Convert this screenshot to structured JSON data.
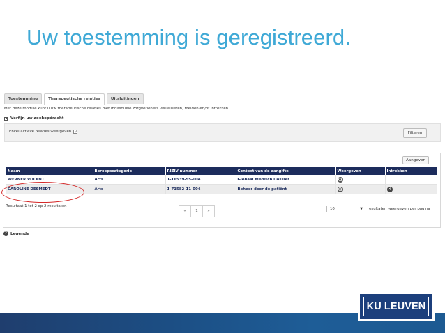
{
  "slide": {
    "title": "Uw toestemming is geregistreerd."
  },
  "tabs": [
    {
      "label": "Toestemming",
      "active": false
    },
    {
      "label": "Therapeutische relaties",
      "active": true
    },
    {
      "label": "Uitsluitingen",
      "active": false
    }
  ],
  "intro_text": "Met deze module kunt u uw therapeutische relaties met individuele zorgverleners visualiseren, melden en/of intrekken.",
  "refine": {
    "header": "Verfijn uw zoekopdracht",
    "checkbox_label": "Enkel actieve relaties weergeven",
    "checkbox_checked": true,
    "filter_button": "Filteren"
  },
  "add_button": "Aangeven",
  "table": {
    "columns": [
      "Naam",
      "Beroepscategorie",
      "RIZIV-nummer",
      "Context van de aangifte",
      "Weergeven",
      "Intrekken"
    ],
    "rows": [
      {
        "name": "WERNER VOLANT",
        "category": "Arts",
        "riziv": "1-16539-55-004",
        "context": "Globaal Medisch Dossier",
        "view_icon": "magnifier-icon",
        "revoke_icon": ""
      },
      {
        "name": "CAROLINE DESMEDT",
        "category": "Arts",
        "riziv": "1-71582-11-004",
        "context": "Beheer door de patiënt",
        "view_icon": "magnifier-icon",
        "revoke_icon": "close-circle-icon"
      }
    ]
  },
  "result_info": "Resultaat 1 tot 2 op 2 resultaten",
  "pagination": {
    "prev": "«",
    "page": "1",
    "next": "»"
  },
  "per_page": {
    "value": "10",
    "label": "resultaten weergeven per pagina"
  },
  "legend": "Legende",
  "logo": {
    "text": "KU LEUVEN"
  },
  "colors": {
    "title": "#3fa9d6",
    "table_header": "#1c2c5c",
    "highlight_ellipse": "#d42a2a",
    "logo_bg": "#1c3f7c"
  }
}
